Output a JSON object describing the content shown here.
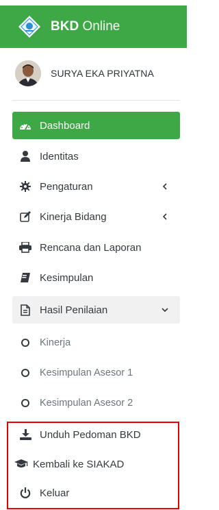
{
  "brand": {
    "bold": "BKD",
    "light": "Online"
  },
  "user": {
    "name": "SURYA EKA PRIYATNA"
  },
  "colors": {
    "accent": "#3fa846",
    "highlight_box": "#e60000",
    "subitem_text": "#6c757d"
  },
  "menu": [
    {
      "label": "Dashboard",
      "icon": "dashboard-gauge-icon",
      "state": "active"
    },
    {
      "label": "Identitas",
      "icon": "user-icon"
    },
    {
      "label": "Pengaturan",
      "icon": "gear-icon",
      "chevron": "left"
    },
    {
      "label": "Kinerja Bidang",
      "icon": "edit-icon",
      "chevron": "left"
    },
    {
      "label": "Rencana dan Laporan",
      "icon": "printer-icon"
    },
    {
      "label": "Kesimpulan",
      "icon": "book-icon"
    },
    {
      "label": "Hasil Penilaian",
      "icon": "document-icon",
      "chevron": "down",
      "state": "open"
    },
    {
      "label": "Kinerja",
      "icon": "circle-icon",
      "sub": true
    },
    {
      "label": "Kesimpulan Asesor 1",
      "icon": "circle-icon",
      "sub": true
    },
    {
      "label": "Kesimpulan Asesor 2",
      "icon": "circle-icon",
      "sub": true
    },
    {
      "label": "Unduh Pedoman BKD",
      "icon": "download-icon"
    },
    {
      "label": "Kembali ke SIAKAD",
      "icon": "graduation-cap-icon"
    },
    {
      "label": "Keluar",
      "icon": "power-icon"
    }
  ]
}
